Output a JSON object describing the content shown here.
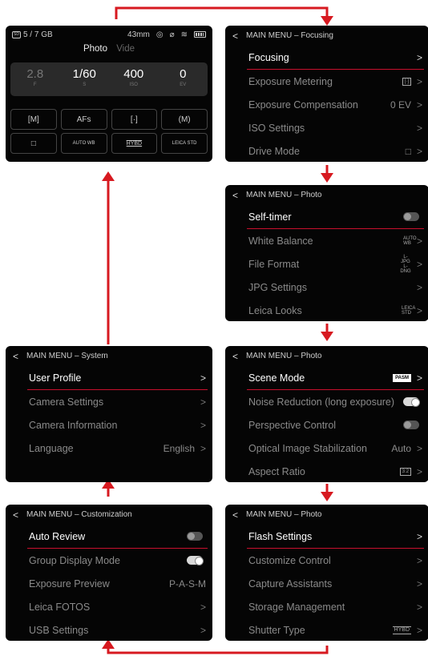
{
  "status_screen": {
    "storage": "5 / 7 GB",
    "sd_label": "SD",
    "focal_length": "43mm",
    "mode_photo": "Photo",
    "mode_video": "Vide",
    "exposure": [
      {
        "value": "2.8",
        "unit": "F",
        "dim": true
      },
      {
        "value": "1/60",
        "unit": "S",
        "dim": false
      },
      {
        "value": "400",
        "unit": "ISO",
        "dim": false
      },
      {
        "value": "0",
        "unit": "EV",
        "dim": false
      }
    ],
    "buttons": [
      "[M]",
      "AFs",
      "[·]",
      "(M)",
      "□",
      "AUTO WB",
      "HYBD",
      "LEICA STD"
    ]
  },
  "focusing_menu": {
    "header": "MAIN MENU – Focusing",
    "items": [
      {
        "label": "Focusing",
        "value": "",
        "active": true
      },
      {
        "label": "Exposure Metering",
        "value": "[·]",
        "active": false
      },
      {
        "label": "Exposure Compensation",
        "value": "0 EV",
        "active": false
      },
      {
        "label": "ISO Settings",
        "value": "",
        "active": false
      },
      {
        "label": "Drive Mode",
        "value": "□",
        "active": false
      }
    ]
  },
  "photo_menu_1": {
    "header": "MAIN MENU – Photo",
    "items": [
      {
        "label": "Self-timer",
        "value": "toggle-off",
        "active": true
      },
      {
        "label": "White Balance",
        "value": "AUTO WB",
        "active": false
      },
      {
        "label": "File Format",
        "value": "L-JPG L-DNG",
        "active": false
      },
      {
        "label": "JPG Settings",
        "value": "",
        "active": false
      },
      {
        "label": "Leica Looks",
        "value": "LEICA STD",
        "active": false
      }
    ]
  },
  "photo_menu_2": {
    "header": "MAIN MENU – Photo",
    "items": [
      {
        "label": "Scene Mode",
        "value": "PASM",
        "active": true
      },
      {
        "label": "Noise Reduction (long exposure)",
        "value": "toggle-on",
        "active": false
      },
      {
        "label": "Perspective Control",
        "value": "toggle-off",
        "active": false
      },
      {
        "label": "Optical Image Stabilization",
        "value": "Auto",
        "active": false
      },
      {
        "label": "Aspect Ratio",
        "value": "3:2",
        "active": false
      }
    ]
  },
  "photo_menu_3": {
    "header": "MAIN MENU – Photo",
    "items": [
      {
        "label": "Flash Settings",
        "value": "",
        "active": true
      },
      {
        "label": "Customize Control",
        "value": "",
        "active": false
      },
      {
        "label": "Capture Assistants",
        "value": "",
        "active": false
      },
      {
        "label": "Storage Management",
        "value": "",
        "active": false
      },
      {
        "label": "Shutter Type",
        "value": "HYBD",
        "active": false
      }
    ]
  },
  "system_menu": {
    "header": "MAIN MENU – System",
    "items": [
      {
        "label": "User Profile",
        "value": "",
        "active": true
      },
      {
        "label": "Camera Settings",
        "value": "",
        "active": false
      },
      {
        "label": "Camera Information",
        "value": "",
        "active": false
      },
      {
        "label": "Language",
        "value": "English",
        "active": false
      }
    ]
  },
  "customization_menu": {
    "header": "MAIN MENU – Customization",
    "items": [
      {
        "label": "Auto Review",
        "value": "toggle-off",
        "active": true
      },
      {
        "label": "Group Display Mode",
        "value": "toggle-on",
        "active": false
      },
      {
        "label": "Exposure Preview",
        "value": "P-A-S-M",
        "active": false
      },
      {
        "label": "Leica FOTOS",
        "value": "",
        "active": false
      },
      {
        "label": "USB Settings",
        "value": "",
        "active": false
      }
    ]
  },
  "colors": {
    "accent_red": "#d71920",
    "screen_bg": "#050505"
  }
}
